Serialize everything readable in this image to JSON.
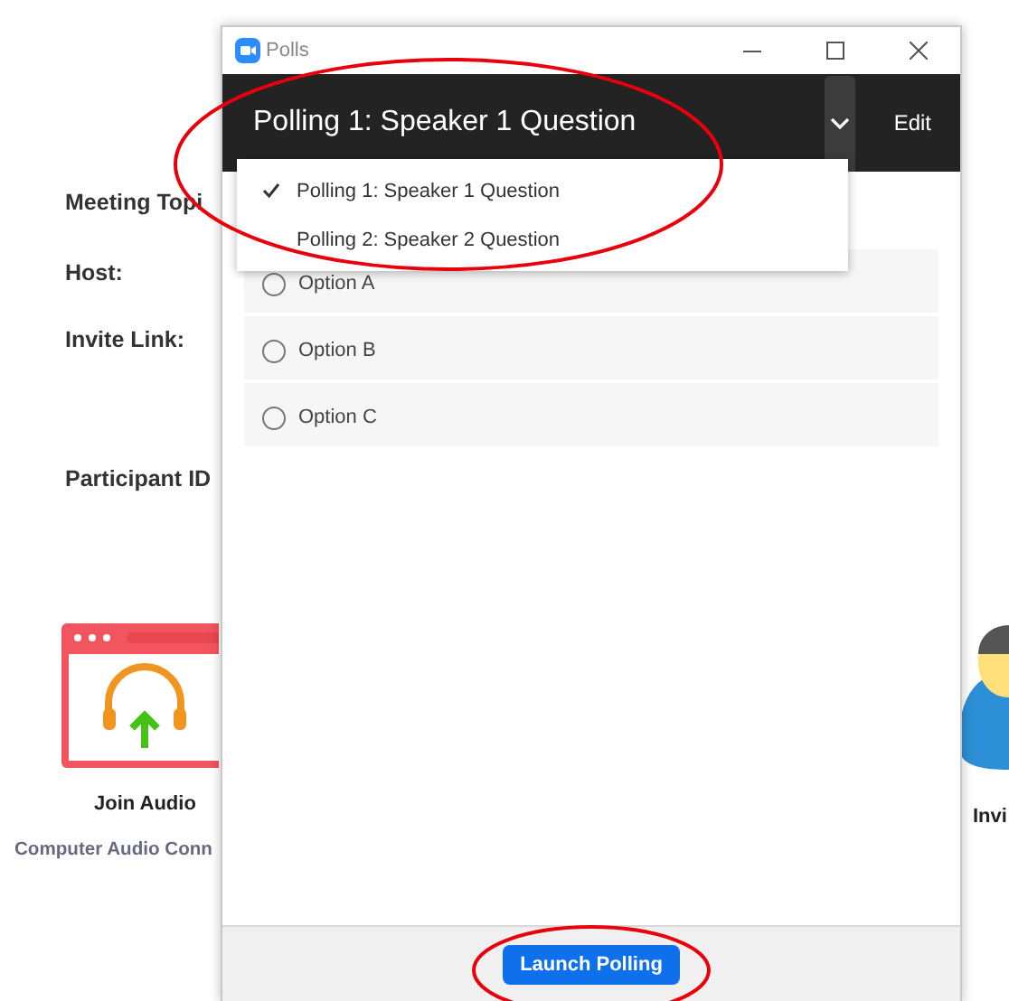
{
  "background": {
    "labels": [
      "Meeting Topi",
      "Host:",
      "Invite Link:",
      "Participant ID"
    ],
    "join_audio": {
      "label": "Join Audio",
      "caption": "Computer Audio Conn"
    },
    "invite": {
      "label": "Invi"
    }
  },
  "window": {
    "title": "Polls",
    "poll_title": "Polling 1: Speaker 1 Question",
    "edit": "Edit",
    "options": [
      {
        "label": "Option A",
        "selected": false
      },
      {
        "label": "Option B",
        "selected": false
      },
      {
        "label": "Option C",
        "selected": false
      }
    ],
    "button": "Launch Polling"
  },
  "poll_menu": {
    "items": [
      {
        "label": "Polling 1: Speaker 1 Question",
        "selected": true
      },
      {
        "label": "Polling 2: Speaker 2 Question",
        "selected": false
      }
    ]
  }
}
